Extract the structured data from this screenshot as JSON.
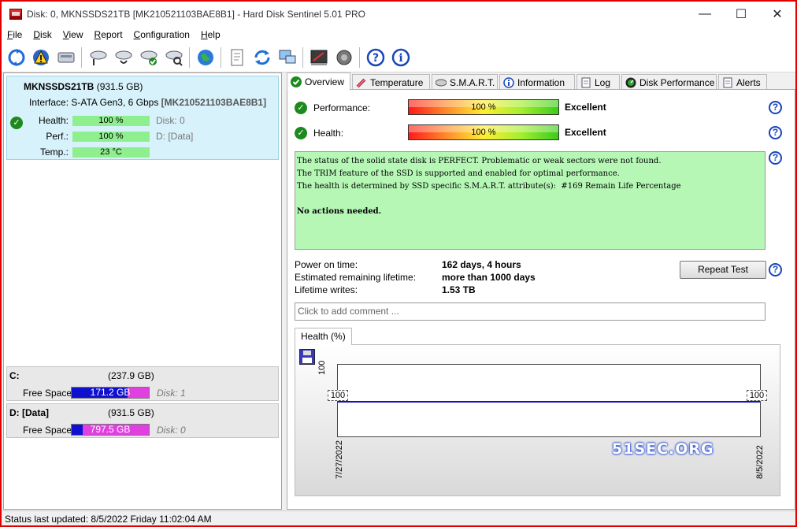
{
  "window": {
    "title": "Disk: 0, MKNSSDS21TB [MK210521103BAE8B1]  -  Hard Disk Sentinel 5.01 PRO",
    "controls": {
      "minimize": "—",
      "maximize": "☐",
      "close": "✕"
    }
  },
  "menu": [
    {
      "u": "F",
      "rest": "ile"
    },
    {
      "u": "D",
      "rest": "isk"
    },
    {
      "u": "V",
      "rest": "iew"
    },
    {
      "u": "R",
      "rest": "eport"
    },
    {
      "u": "C",
      "rest": "onfiguration"
    },
    {
      "u": "H",
      "rest": "elp"
    }
  ],
  "disk": {
    "name": "MKNSSDS21TB",
    "size": "(931.5 GB)",
    "interface_label": "Interface:",
    "interface_value": "S-ATA Gen3, 6 Gbps",
    "serial": "[MK210521103BAE8B1]",
    "health_label": "Health:",
    "health_value": "100 %",
    "perf_label": "Perf.:",
    "perf_value": "100 %",
    "temp_label": "Temp.:",
    "temp_value": "23 °C",
    "disk_index": "Disk: 0",
    "volume_tag": "D: [Data]"
  },
  "volumes": [
    {
      "name": "C:",
      "size": "(237.9 GB)",
      "free_label": "Free Space",
      "free": "171.2 GB",
      "free_fraction": 0.72,
      "disk": "Disk: 1"
    },
    {
      "name": "D: [Data]",
      "size": "(931.5 GB)",
      "free_label": "Free Space",
      "free": "797.5 GB",
      "free_fraction": 0.14,
      "disk": "Disk: 0"
    }
  ],
  "tabs": [
    {
      "label": "Overview"
    },
    {
      "label": "Temperature"
    },
    {
      "label": "S.M.A.R.T."
    },
    {
      "label": "Information"
    },
    {
      "label": "Log"
    },
    {
      "label": "Disk Performance"
    },
    {
      "label": "Alerts"
    }
  ],
  "overview": {
    "performance_label": "Performance:",
    "performance_value": "100 %",
    "performance_rating": "Excellent",
    "health_label": "Health:",
    "health_value": "100 %",
    "health_rating": "Excellent",
    "status_text": "The status of the solid state disk is PERFECT. Problematic or weak sectors were not found.\nThe TRIM feature of the SSD is supported and enabled for optimal performance.\nThe health is determined by SSD specific S.M.A.R.T. attribute(s):  #169 Remain Life Percentage",
    "actions": "No actions needed.",
    "power_on_label": "Power on time:",
    "power_on_value": "162 days, 4 hours",
    "remaining_label": "Estimated remaining lifetime:",
    "remaining_value": "more than 1000 days",
    "writes_label": "Lifetime writes:",
    "writes_value": "1.53 TB",
    "repeat_button": "Repeat Test",
    "comment_placeholder": "Click to add comment ...",
    "graph_tab": "Health (%)",
    "help_glyph": "?"
  },
  "chart_data": {
    "type": "line",
    "x": [
      "7/27/2022",
      "8/5/2022"
    ],
    "series": [
      {
        "values": [
          100,
          100
        ]
      }
    ],
    "yticks": [
      "100"
    ],
    "ylim": [
      0,
      200
    ],
    "point_labels": [
      "100",
      "100"
    ]
  },
  "watermark": "51SEC.ORG",
  "status_bar": "Status last updated: 8/5/2022 Friday 11:02:04 AM",
  "colors": {
    "accent_red": "#e00000",
    "ok_green": "#1c8a1c",
    "status_bg": "#b6f7b6",
    "help_blue": "#1a47b8",
    "free_fill": "#1010d0",
    "free_bg": "#e040e0"
  }
}
